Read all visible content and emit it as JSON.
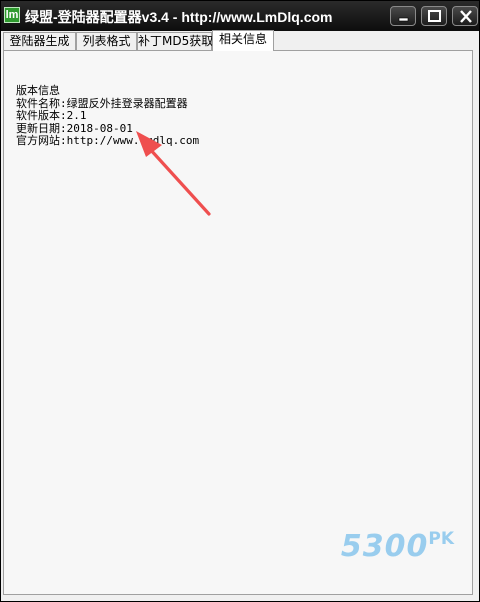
{
  "window": {
    "title": "绿盟-登陆器配置器v3.4 - http://www.LmDlq.com",
    "icon_letter": "lm"
  },
  "tabs": [
    {
      "label": "登陆器生成",
      "active": false
    },
    {
      "label": "列表格式",
      "active": false
    },
    {
      "label": "补丁MD5获取",
      "active": false
    },
    {
      "label": "相关信息",
      "active": true
    }
  ],
  "info": {
    "heading": "版本信息",
    "rows": [
      {
        "label": "软件名称:",
        "value": "绿盟反外挂登录器配置器"
      },
      {
        "label": "软件版本:",
        "value": "2.1"
      },
      {
        "label": "更新日期:",
        "value": "2018-08-01"
      },
      {
        "label": "官方网站:",
        "value": "http://www.lmdlq.com"
      }
    ]
  },
  "watermark": {
    "number": "5300",
    "suffix": "PK"
  },
  "colors": {
    "arrow": "#ef4f4f",
    "watermark": "#8fc9ee",
    "titlebar": "#111111"
  }
}
